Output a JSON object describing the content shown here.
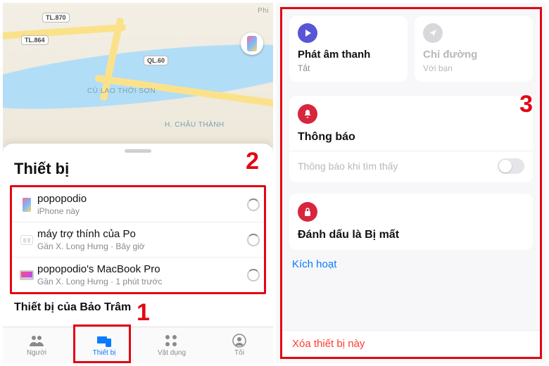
{
  "left": {
    "sheet_title": "Thiết bị",
    "map": {
      "shields": [
        "TL.870",
        "TL.864",
        "QL.60"
      ],
      "labels": [
        "CÙ LAO THỚI SƠN",
        "H. CHÂU THÀNH",
        "Phi"
      ]
    },
    "devices": [
      {
        "name": "popopodio",
        "sub": "iPhone này"
      },
      {
        "name": "máy trợ thính của Po",
        "sub": "Gần X. Long Hưng · Bây giờ"
      },
      {
        "name": "popopodio's MacBook Pro",
        "sub": "Gần X. Long Hưng · 1 phút trước"
      }
    ],
    "shared_section": "Thiết bị của Bảo Trâm",
    "tabs": {
      "people": "Người",
      "devices": "Thiết bị",
      "items": "Vật dụng",
      "me": "Tôi"
    },
    "callouts": {
      "one": "1",
      "two": "2"
    }
  },
  "right": {
    "callout": "3",
    "play_sound": {
      "title": "Phát âm thanh",
      "sub": "Tắt"
    },
    "directions": {
      "title": "Chỉ đường",
      "sub": "Với bạn"
    },
    "notifications": {
      "title": "Thông báo",
      "row_label": "Thông báo khi tìm thấy"
    },
    "lost_mode": {
      "title": "Đánh dấu là Bị mất",
      "activate": "Kích hoạt"
    },
    "remove": "Xóa thiết bị này"
  }
}
